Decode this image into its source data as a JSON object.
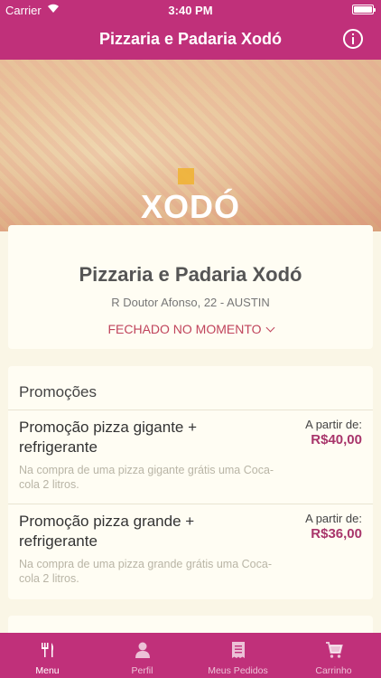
{
  "status_bar": {
    "carrier": "Carrier",
    "time": "3:40 PM"
  },
  "nav": {
    "title": "Pizzaria e Padaria Xodó",
    "info_icon": "info-icon"
  },
  "hero": {
    "logo_text": "XODÓ"
  },
  "store": {
    "name": "Pizzaria e Padaria Xodó",
    "address": "R Doutor Afonso, 22 - AUSTIN",
    "status": "FECHADO NO MOMENTO"
  },
  "promotions": {
    "heading": "Promoções",
    "items": [
      {
        "name": "Promoção pizza gigante + refrigerante",
        "from_label": "A partir de:",
        "price": "R$40,00",
        "description": "Na compra de uma pizza gigante grátis uma Coca-cola 2 litros."
      },
      {
        "name": "Promoção pizza grande + refrigerante",
        "from_label": "A partir de:",
        "price": "R$36,00",
        "description": "Na compra de uma pizza grande grátis uma Coca-cola 2 litros."
      }
    ]
  },
  "tabs": [
    {
      "label": "Menu",
      "icon": "fork-knife-icon",
      "active": true
    },
    {
      "label": "Perfil",
      "icon": "person-icon",
      "active": false
    },
    {
      "label": "Meus Pedidos",
      "icon": "receipt-icon",
      "active": false
    },
    {
      "label": "Carrinho",
      "icon": "cart-icon",
      "active": false
    }
  ],
  "colors": {
    "brand": "#c0307a",
    "price": "#a8356a",
    "status": "#c0445c",
    "background": "#faf6e6"
  }
}
